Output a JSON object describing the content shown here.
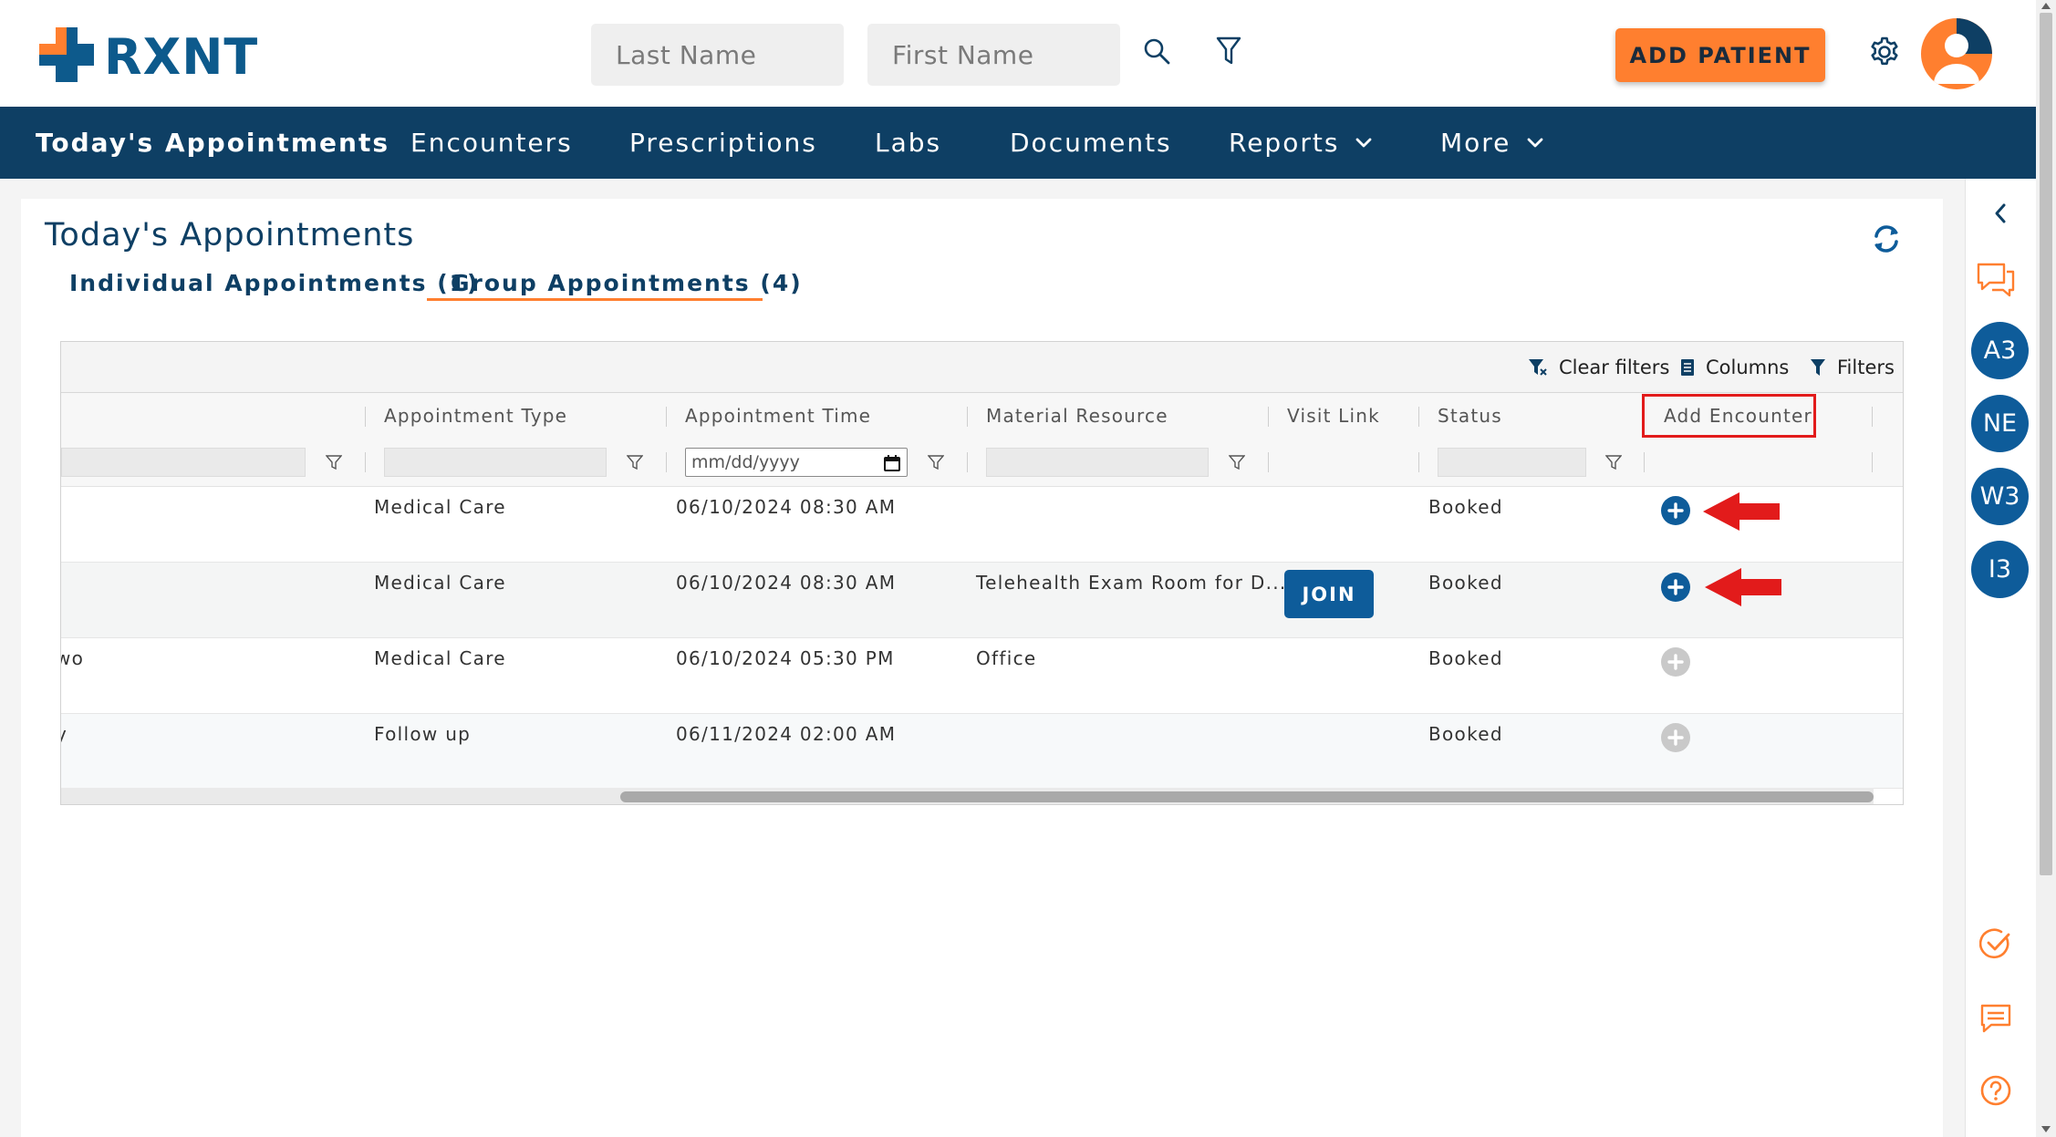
{
  "header": {
    "logo_text": "RXNT",
    "last_name_placeholder": "Last Name",
    "first_name_placeholder": "First Name",
    "add_patient_label": "ADD PATIENT"
  },
  "nav": {
    "items": [
      {
        "label": "Today's Appointments",
        "active": true
      },
      {
        "label": "Encounters"
      },
      {
        "label": "Prescriptions"
      },
      {
        "label": "Labs"
      },
      {
        "label": "Documents"
      },
      {
        "label": "Reports",
        "dropdown": true
      },
      {
        "label": "More",
        "dropdown": true
      }
    ]
  },
  "page": {
    "title": "Today's Appointments",
    "tabs": [
      {
        "label": "Individual Appointments (1)"
      },
      {
        "label": "Group Appointments (4)",
        "active": true
      }
    ]
  },
  "grid": {
    "toolbar": {
      "clear_filters": "Clear filters",
      "columns": "Columns",
      "filters": "Filters"
    },
    "columns": [
      "Appointment Type",
      "Appointment Time",
      "Material Resource",
      "Visit Link",
      "Status",
      "Add Encounter"
    ],
    "date_placeholder": "mm/dd/yyyy",
    "rows": [
      {
        "name": "",
        "type": "Medical Care",
        "time": "06/10/2024 08:30 AM",
        "resource": "",
        "visit_link": "",
        "status": "Booked",
        "add_enabled": true
      },
      {
        "name": "",
        "type": "Medical Care",
        "time": "06/10/2024 08:30 AM",
        "resource": "Telehealth Exam Room for D...",
        "visit_link": "JOIN",
        "status": "Booked",
        "add_enabled": true
      },
      {
        "name": "wo",
        "type": "Medical Care",
        "time": "06/10/2024 05:30 PM",
        "resource": "Office",
        "visit_link": "",
        "status": "Booked",
        "add_enabled": false
      },
      {
        "name": "y",
        "type": "Follow up",
        "time": "06/11/2024 02:00 AM",
        "resource": "",
        "visit_link": "",
        "status": "Booked",
        "add_enabled": false
      }
    ]
  },
  "sidebar": {
    "badges": [
      "A3",
      "NE",
      "W3",
      "I3"
    ]
  },
  "colors": {
    "brand_navy": "#0e3f64",
    "brand_orange": "#ff7f2f",
    "primary_blue": "#0e5c9a",
    "annotation_red": "#e21b1b"
  }
}
